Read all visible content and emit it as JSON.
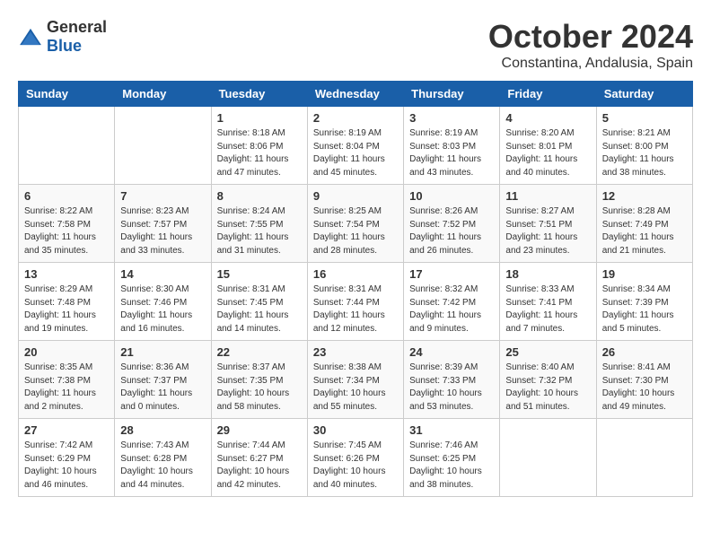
{
  "logo": {
    "text_general": "General",
    "text_blue": "Blue"
  },
  "title": {
    "month": "October 2024",
    "location": "Constantina, Andalusia, Spain"
  },
  "weekdays": [
    "Sunday",
    "Monday",
    "Tuesday",
    "Wednesday",
    "Thursday",
    "Friday",
    "Saturday"
  ],
  "weeks": [
    [
      {
        "day": "",
        "info": ""
      },
      {
        "day": "",
        "info": ""
      },
      {
        "day": "1",
        "info": "Sunrise: 8:18 AM\nSunset: 8:06 PM\nDaylight: 11 hours and 47 minutes."
      },
      {
        "day": "2",
        "info": "Sunrise: 8:19 AM\nSunset: 8:04 PM\nDaylight: 11 hours and 45 minutes."
      },
      {
        "day": "3",
        "info": "Sunrise: 8:19 AM\nSunset: 8:03 PM\nDaylight: 11 hours and 43 minutes."
      },
      {
        "day": "4",
        "info": "Sunrise: 8:20 AM\nSunset: 8:01 PM\nDaylight: 11 hours and 40 minutes."
      },
      {
        "day": "5",
        "info": "Sunrise: 8:21 AM\nSunset: 8:00 PM\nDaylight: 11 hours and 38 minutes."
      }
    ],
    [
      {
        "day": "6",
        "info": "Sunrise: 8:22 AM\nSunset: 7:58 PM\nDaylight: 11 hours and 35 minutes."
      },
      {
        "day": "7",
        "info": "Sunrise: 8:23 AM\nSunset: 7:57 PM\nDaylight: 11 hours and 33 minutes."
      },
      {
        "day": "8",
        "info": "Sunrise: 8:24 AM\nSunset: 7:55 PM\nDaylight: 11 hours and 31 minutes."
      },
      {
        "day": "9",
        "info": "Sunrise: 8:25 AM\nSunset: 7:54 PM\nDaylight: 11 hours and 28 minutes."
      },
      {
        "day": "10",
        "info": "Sunrise: 8:26 AM\nSunset: 7:52 PM\nDaylight: 11 hours and 26 minutes."
      },
      {
        "day": "11",
        "info": "Sunrise: 8:27 AM\nSunset: 7:51 PM\nDaylight: 11 hours and 23 minutes."
      },
      {
        "day": "12",
        "info": "Sunrise: 8:28 AM\nSunset: 7:49 PM\nDaylight: 11 hours and 21 minutes."
      }
    ],
    [
      {
        "day": "13",
        "info": "Sunrise: 8:29 AM\nSunset: 7:48 PM\nDaylight: 11 hours and 19 minutes."
      },
      {
        "day": "14",
        "info": "Sunrise: 8:30 AM\nSunset: 7:46 PM\nDaylight: 11 hours and 16 minutes."
      },
      {
        "day": "15",
        "info": "Sunrise: 8:31 AM\nSunset: 7:45 PM\nDaylight: 11 hours and 14 minutes."
      },
      {
        "day": "16",
        "info": "Sunrise: 8:31 AM\nSunset: 7:44 PM\nDaylight: 11 hours and 12 minutes."
      },
      {
        "day": "17",
        "info": "Sunrise: 8:32 AM\nSunset: 7:42 PM\nDaylight: 11 hours and 9 minutes."
      },
      {
        "day": "18",
        "info": "Sunrise: 8:33 AM\nSunset: 7:41 PM\nDaylight: 11 hours and 7 minutes."
      },
      {
        "day": "19",
        "info": "Sunrise: 8:34 AM\nSunset: 7:39 PM\nDaylight: 11 hours and 5 minutes."
      }
    ],
    [
      {
        "day": "20",
        "info": "Sunrise: 8:35 AM\nSunset: 7:38 PM\nDaylight: 11 hours and 2 minutes."
      },
      {
        "day": "21",
        "info": "Sunrise: 8:36 AM\nSunset: 7:37 PM\nDaylight: 11 hours and 0 minutes."
      },
      {
        "day": "22",
        "info": "Sunrise: 8:37 AM\nSunset: 7:35 PM\nDaylight: 10 hours and 58 minutes."
      },
      {
        "day": "23",
        "info": "Sunrise: 8:38 AM\nSunset: 7:34 PM\nDaylight: 10 hours and 55 minutes."
      },
      {
        "day": "24",
        "info": "Sunrise: 8:39 AM\nSunset: 7:33 PM\nDaylight: 10 hours and 53 minutes."
      },
      {
        "day": "25",
        "info": "Sunrise: 8:40 AM\nSunset: 7:32 PM\nDaylight: 10 hours and 51 minutes."
      },
      {
        "day": "26",
        "info": "Sunrise: 8:41 AM\nSunset: 7:30 PM\nDaylight: 10 hours and 49 minutes."
      }
    ],
    [
      {
        "day": "27",
        "info": "Sunrise: 7:42 AM\nSunset: 6:29 PM\nDaylight: 10 hours and 46 minutes."
      },
      {
        "day": "28",
        "info": "Sunrise: 7:43 AM\nSunset: 6:28 PM\nDaylight: 10 hours and 44 minutes."
      },
      {
        "day": "29",
        "info": "Sunrise: 7:44 AM\nSunset: 6:27 PM\nDaylight: 10 hours and 42 minutes."
      },
      {
        "day": "30",
        "info": "Sunrise: 7:45 AM\nSunset: 6:26 PM\nDaylight: 10 hours and 40 minutes."
      },
      {
        "day": "31",
        "info": "Sunrise: 7:46 AM\nSunset: 6:25 PM\nDaylight: 10 hours and 38 minutes."
      },
      {
        "day": "",
        "info": ""
      },
      {
        "day": "",
        "info": ""
      }
    ]
  ]
}
